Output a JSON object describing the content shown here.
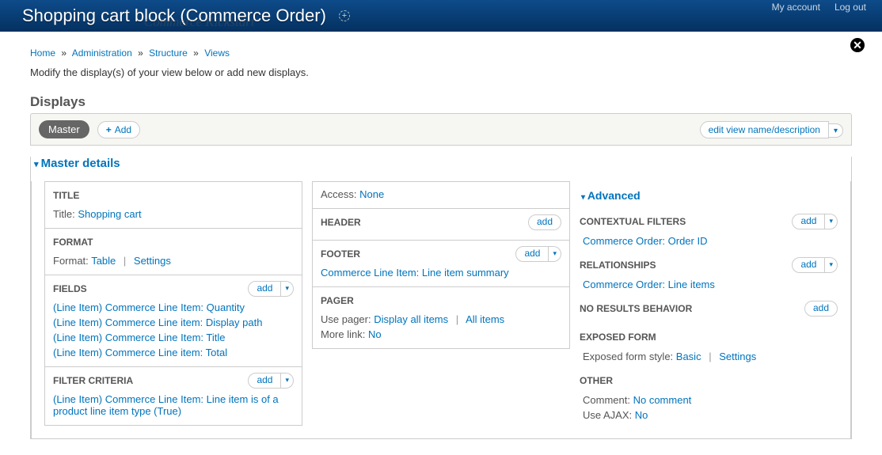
{
  "topbar": {
    "title": "Shopping cart block (Commerce Order)",
    "behind_text": "Commerce Kickstart",
    "my_account": "My account",
    "log_out": "Log out"
  },
  "breadcrumb": [
    {
      "label": "Home"
    },
    {
      "label": "Administration"
    },
    {
      "label": "Structure"
    },
    {
      "label": "Views"
    }
  ],
  "intro": "Modify the display(s) of your view below or add new displays.",
  "displays": {
    "heading": "Displays",
    "master_btn": "Master",
    "add_btn": "Add",
    "edit_name": "edit view name/description",
    "details_label": "Master details"
  },
  "col1": {
    "title_hdr": "TITLE",
    "title_label": "Title:",
    "title_value": "Shopping cart",
    "format_hdr": "FORMAT",
    "format_label": "Format:",
    "format_value": "Table",
    "format_settings": "Settings",
    "fields_hdr": "FIELDS",
    "fields_add": "add",
    "fields": [
      "(Line Item) Commerce Line Item: Quantity",
      "(Line Item) Commerce Line item: Display path",
      "(Line Item) Commerce Line Item: Title",
      "(Line Item) Commerce Line item: Total"
    ],
    "filter_hdr": "FILTER CRITERIA",
    "filter_add": "add",
    "filters": [
      "(Line Item) Commerce Line Item: Line item is of a product line item type (True)"
    ]
  },
  "col2": {
    "access_label": "Access:",
    "access_value": "None",
    "header_hdr": "HEADER",
    "header_add": "add",
    "footer_hdr": "FOOTER",
    "footer_add": "add",
    "footer_items": [
      "Commerce Line Item: Line item summary"
    ],
    "pager_hdr": "PAGER",
    "pager_label": "Use pager:",
    "pager_value": "Display all items",
    "pager_value2": "All items",
    "more_label": "More link:",
    "more_value": "No"
  },
  "col3": {
    "advanced": "Advanced",
    "contextual_hdr": "CONTEXTUAL FILTERS",
    "contextual_add": "add",
    "contextual_items": [
      "Commerce Order: Order ID"
    ],
    "relationships_hdr": "RELATIONSHIPS",
    "relationships_add": "add",
    "relationships_items": [
      "Commerce Order: Line items"
    ],
    "noresults_hdr": "NO RESULTS BEHAVIOR",
    "noresults_add": "add",
    "exposed_hdr": "EXPOSED FORM",
    "exposed_label": "Exposed form style:",
    "exposed_value": "Basic",
    "exposed_settings": "Settings",
    "other_hdr": "OTHER",
    "comment_label": "Comment:",
    "comment_value": "No comment",
    "ajax_label": "Use AJAX:",
    "ajax_value": "No"
  }
}
